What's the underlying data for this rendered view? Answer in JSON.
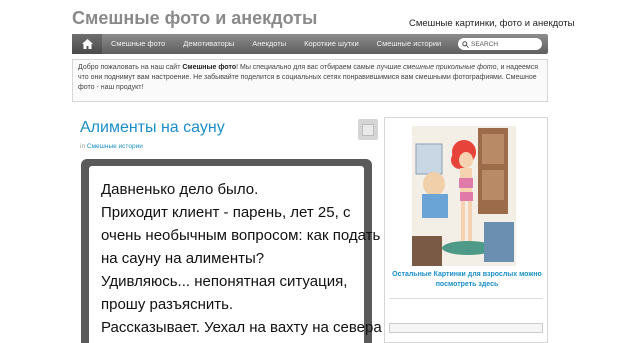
{
  "site": {
    "title": "Смешные фото и анекдоты",
    "tagline": "Смешные картинки, фото и анекдоты"
  },
  "nav": {
    "home_icon": "home-icon",
    "items": [
      "Смешные фото",
      "Демотиваторы",
      "Анекдоты",
      "Короткие шутки",
      "Смешные истории"
    ],
    "search_placeholder": "SEARCH"
  },
  "welcome": {
    "part1": "Добро пожаловать на наш сайт ",
    "bold": "Смешные фото",
    "part2": "! Мы специально для вас отбираем самые лучшие ",
    "italic": "смешные прикольные фото",
    "part3": ", и надеемся что они поднимут вам настроение. Не забывайте поделится в социальных сетях понравившимися вам смешными фотографиями. Смешное фото - наш продукт!"
  },
  "post": {
    "title": "Алименты на сауну",
    "meta_prefix": "in",
    "category": "Смешные истории",
    "lines": [
      "Давненько дело было.",
      "Приходит клиент - парень, лет 25, с",
      "очень необычным вопросом: как подать",
      "на сауну на алименты?",
      "Удивляюсь... непонятная ситуация,",
      "прошу разъяснить.",
      "Рассказывает. Уехал на вахту на севера"
    ]
  },
  "sidebar": {
    "link_text": "Остальные Картинки для взрослых можно посмотреть здесь"
  }
}
